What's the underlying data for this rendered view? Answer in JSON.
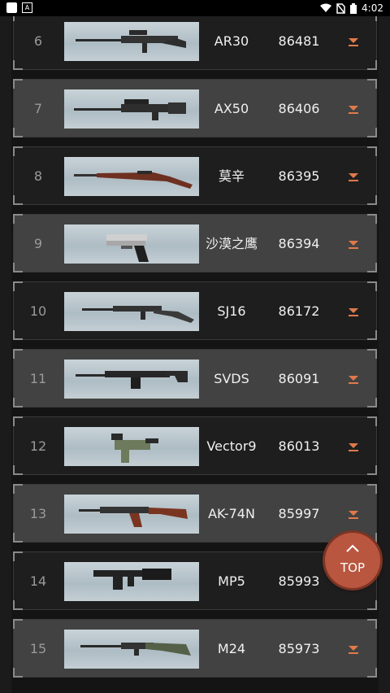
{
  "status_bar": {
    "time": "4:02",
    "icons": [
      "app-icon",
      "a-icon",
      "wifi-icon",
      "no-sim-icon",
      "battery-icon"
    ]
  },
  "accent_color": "#e07a4a",
  "top_button": {
    "label": "TOP"
  },
  "rows": [
    {
      "rank": "6",
      "name": "AR30",
      "score": "86481",
      "weapon_icon": "sniper-rifle-icon"
    },
    {
      "rank": "7",
      "name": "AX50",
      "score": "86406",
      "weapon_icon": "heavy-sniper-icon"
    },
    {
      "rank": "8",
      "name": "莫辛",
      "score": "86395",
      "weapon_icon": "bolt-rifle-icon"
    },
    {
      "rank": "9",
      "name": "沙漠之鹰",
      "score": "86394",
      "weapon_icon": "pistol-icon"
    },
    {
      "rank": "10",
      "name": "SJ16",
      "score": "86172",
      "weapon_icon": "marksman-rifle-icon"
    },
    {
      "rank": "11",
      "name": "SVDS",
      "score": "86091",
      "weapon_icon": "dmr-icon"
    },
    {
      "rank": "12",
      "name": "Vector9",
      "score": "86013",
      "weapon_icon": "smg-icon"
    },
    {
      "rank": "13",
      "name": "AK-74N",
      "score": "85997",
      "weapon_icon": "assault-rifle-icon"
    },
    {
      "rank": "14",
      "name": "MP5",
      "score": "85993",
      "weapon_icon": "smg-icon"
    },
    {
      "rank": "15",
      "name": "M24",
      "score": "85973",
      "weapon_icon": "sniper-rifle-icon"
    }
  ]
}
